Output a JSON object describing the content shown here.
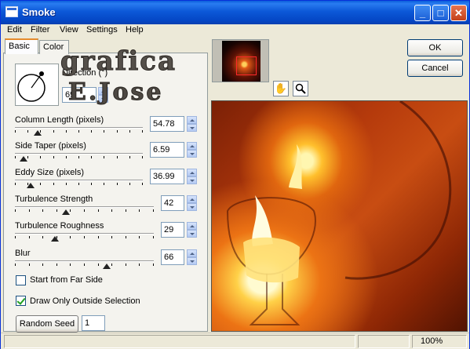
{
  "window": {
    "title": "Smoke"
  },
  "menu": [
    "Edit",
    "Filter",
    "View",
    "Settings",
    "Help"
  ],
  "tabs": [
    {
      "label": "Basic",
      "active": true
    },
    {
      "label": "Color",
      "active": false
    }
  ],
  "direction": {
    "label": "Direction (°)",
    "value": "69"
  },
  "sliders": [
    {
      "label": "Column Length (pixels)",
      "value": "54.78",
      "level": 0.18
    },
    {
      "label": "Side Taper (pixels)",
      "value": "6.59",
      "level": 0.07
    },
    {
      "label": "Eddy Size (pixels)",
      "value": "36.99",
      "level": 0.12
    },
    {
      "label": "Turbulence Strength",
      "value": "42",
      "level": 0.37
    },
    {
      "label": "Turbulence Roughness",
      "value": "29",
      "level": 0.29
    },
    {
      "label": "Blur",
      "value": "66",
      "level": 0.66
    }
  ],
  "checkboxes": [
    {
      "label": "Start from Far Side",
      "checked": false
    },
    {
      "label": "Draw Only Outside Selection",
      "checked": true
    }
  ],
  "random_seed": {
    "button_label": "Random Seed",
    "value": "1"
  },
  "buttons": {
    "ok": "OK",
    "cancel": "Cancel"
  },
  "status": {
    "zoom": "100%"
  },
  "watermark": {
    "line1": "grafica",
    "line2": "E.Jose"
  }
}
